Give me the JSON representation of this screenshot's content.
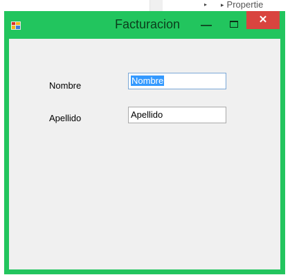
{
  "background": {
    "item_label": "Propertie"
  },
  "window": {
    "title": "Facturacion",
    "accent_color": "#22c55e",
    "close_color": "#d9443f",
    "icons": {
      "app": "app-icon",
      "minimize": "minimize-icon",
      "maximize": "maximize-icon",
      "close": "close-icon"
    },
    "close_glyph": "✕",
    "minimize_glyph": "—"
  },
  "form": {
    "nombre_label": "Nombre",
    "nombre_value": "Nombre",
    "apellido_label": "Apellido",
    "apellido_value": "Apellido"
  }
}
